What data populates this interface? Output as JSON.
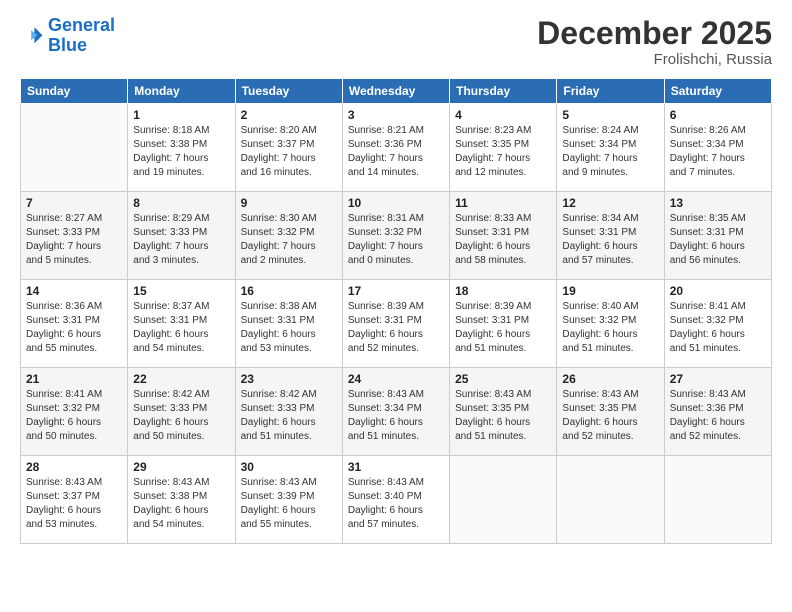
{
  "logo": {
    "line1": "General",
    "line2": "Blue"
  },
  "title": "December 2025",
  "location": "Frolishchi, Russia",
  "days_of_week": [
    "Sunday",
    "Monday",
    "Tuesday",
    "Wednesday",
    "Thursday",
    "Friday",
    "Saturday"
  ],
  "weeks": [
    [
      {
        "day": "",
        "info": ""
      },
      {
        "day": "1",
        "info": "Sunrise: 8:18 AM\nSunset: 3:38 PM\nDaylight: 7 hours\nand 19 minutes."
      },
      {
        "day": "2",
        "info": "Sunrise: 8:20 AM\nSunset: 3:37 PM\nDaylight: 7 hours\nand 16 minutes."
      },
      {
        "day": "3",
        "info": "Sunrise: 8:21 AM\nSunset: 3:36 PM\nDaylight: 7 hours\nand 14 minutes."
      },
      {
        "day": "4",
        "info": "Sunrise: 8:23 AM\nSunset: 3:35 PM\nDaylight: 7 hours\nand 12 minutes."
      },
      {
        "day": "5",
        "info": "Sunrise: 8:24 AM\nSunset: 3:34 PM\nDaylight: 7 hours\nand 9 minutes."
      },
      {
        "day": "6",
        "info": "Sunrise: 8:26 AM\nSunset: 3:34 PM\nDaylight: 7 hours\nand 7 minutes."
      }
    ],
    [
      {
        "day": "7",
        "info": "Sunrise: 8:27 AM\nSunset: 3:33 PM\nDaylight: 7 hours\nand 5 minutes."
      },
      {
        "day": "8",
        "info": "Sunrise: 8:29 AM\nSunset: 3:33 PM\nDaylight: 7 hours\nand 3 minutes."
      },
      {
        "day": "9",
        "info": "Sunrise: 8:30 AM\nSunset: 3:32 PM\nDaylight: 7 hours\nand 2 minutes."
      },
      {
        "day": "10",
        "info": "Sunrise: 8:31 AM\nSunset: 3:32 PM\nDaylight: 7 hours\nand 0 minutes."
      },
      {
        "day": "11",
        "info": "Sunrise: 8:33 AM\nSunset: 3:31 PM\nDaylight: 6 hours\nand 58 minutes."
      },
      {
        "day": "12",
        "info": "Sunrise: 8:34 AM\nSunset: 3:31 PM\nDaylight: 6 hours\nand 57 minutes."
      },
      {
        "day": "13",
        "info": "Sunrise: 8:35 AM\nSunset: 3:31 PM\nDaylight: 6 hours\nand 56 minutes."
      }
    ],
    [
      {
        "day": "14",
        "info": "Sunrise: 8:36 AM\nSunset: 3:31 PM\nDaylight: 6 hours\nand 55 minutes."
      },
      {
        "day": "15",
        "info": "Sunrise: 8:37 AM\nSunset: 3:31 PM\nDaylight: 6 hours\nand 54 minutes."
      },
      {
        "day": "16",
        "info": "Sunrise: 8:38 AM\nSunset: 3:31 PM\nDaylight: 6 hours\nand 53 minutes."
      },
      {
        "day": "17",
        "info": "Sunrise: 8:39 AM\nSunset: 3:31 PM\nDaylight: 6 hours\nand 52 minutes."
      },
      {
        "day": "18",
        "info": "Sunrise: 8:39 AM\nSunset: 3:31 PM\nDaylight: 6 hours\nand 51 minutes."
      },
      {
        "day": "19",
        "info": "Sunrise: 8:40 AM\nSunset: 3:32 PM\nDaylight: 6 hours\nand 51 minutes."
      },
      {
        "day": "20",
        "info": "Sunrise: 8:41 AM\nSunset: 3:32 PM\nDaylight: 6 hours\nand 51 minutes."
      }
    ],
    [
      {
        "day": "21",
        "info": "Sunrise: 8:41 AM\nSunset: 3:32 PM\nDaylight: 6 hours\nand 50 minutes."
      },
      {
        "day": "22",
        "info": "Sunrise: 8:42 AM\nSunset: 3:33 PM\nDaylight: 6 hours\nand 50 minutes."
      },
      {
        "day": "23",
        "info": "Sunrise: 8:42 AM\nSunset: 3:33 PM\nDaylight: 6 hours\nand 51 minutes."
      },
      {
        "day": "24",
        "info": "Sunrise: 8:43 AM\nSunset: 3:34 PM\nDaylight: 6 hours\nand 51 minutes."
      },
      {
        "day": "25",
        "info": "Sunrise: 8:43 AM\nSunset: 3:35 PM\nDaylight: 6 hours\nand 51 minutes."
      },
      {
        "day": "26",
        "info": "Sunrise: 8:43 AM\nSunset: 3:35 PM\nDaylight: 6 hours\nand 52 minutes."
      },
      {
        "day": "27",
        "info": "Sunrise: 8:43 AM\nSunset: 3:36 PM\nDaylight: 6 hours\nand 52 minutes."
      }
    ],
    [
      {
        "day": "28",
        "info": "Sunrise: 8:43 AM\nSunset: 3:37 PM\nDaylight: 6 hours\nand 53 minutes."
      },
      {
        "day": "29",
        "info": "Sunrise: 8:43 AM\nSunset: 3:38 PM\nDaylight: 6 hours\nand 54 minutes."
      },
      {
        "day": "30",
        "info": "Sunrise: 8:43 AM\nSunset: 3:39 PM\nDaylight: 6 hours\nand 55 minutes."
      },
      {
        "day": "31",
        "info": "Sunrise: 8:43 AM\nSunset: 3:40 PM\nDaylight: 6 hours\nand 57 minutes."
      },
      {
        "day": "",
        "info": ""
      },
      {
        "day": "",
        "info": ""
      },
      {
        "day": "",
        "info": ""
      }
    ]
  ]
}
